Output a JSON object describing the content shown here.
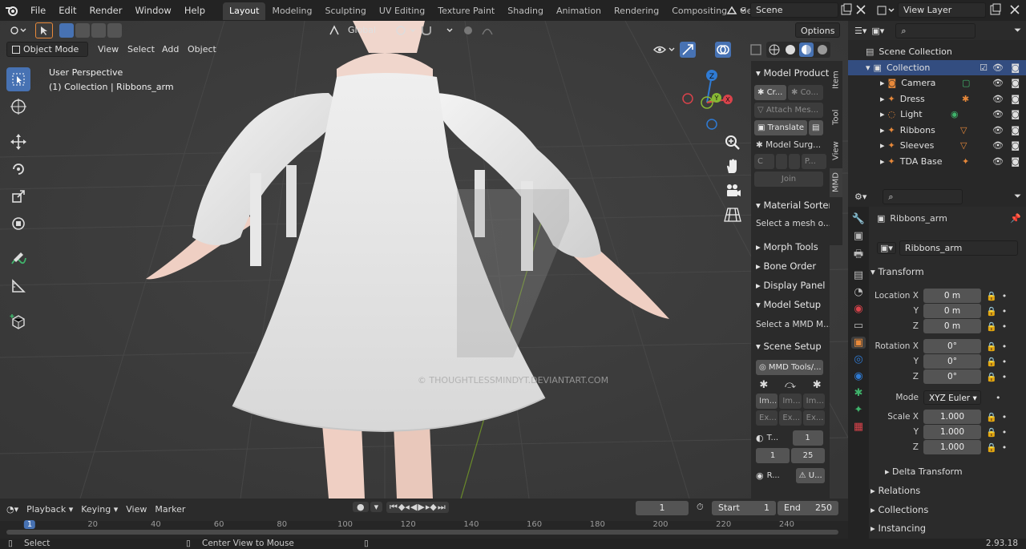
{
  "menu": {
    "file": "File",
    "edit": "Edit",
    "render": "Render",
    "window": "Window",
    "help": "Help"
  },
  "workspaces": [
    "Layout",
    "Modeling",
    "Sculpting",
    "UV Editing",
    "Texture Paint",
    "Shading",
    "Animation",
    "Rendering",
    "Compositing",
    "Geometry No"
  ],
  "scene": "Scene",
  "view_layer": "View Layer",
  "viewport": {
    "mode": "Object Mode",
    "view": "View",
    "select": "Select",
    "add": "Add",
    "object": "Object",
    "orientation": "Global",
    "options": "Options",
    "perspective": "User Perspective",
    "collection_info": "(1) Collection | Ribbons_arm",
    "watermark": "© THOUGHTLESSMINDYT.DEVIANTART.COM",
    "gizmo": {
      "z": "Z",
      "y": "Y",
      "x": "X"
    }
  },
  "npanel": {
    "tabs": [
      "Item",
      "Tool",
      "View",
      "MMD"
    ],
    "model_production": "Model Producti",
    "btn_create": "Cr...",
    "btn_convert": "Co...",
    "btn_attach": "Attach Mes...",
    "btn_translate": "Translate",
    "btn_model_surgery": "Model Surg...",
    "btn_c": "C",
    "btn_p": "P...",
    "btn_join": "Join",
    "material_sorter": "Material Sorter",
    "select_mesh": "Select a mesh o...",
    "morph_tools": "Morph Tools",
    "bone_order": "Bone Order",
    "display_panel": "Display Panel",
    "model_setup": "Model Setup",
    "select_mmd": "Select a MMD M...",
    "scene_setup": "Scene Setup",
    "mmd_tools": "MMD Tools/...",
    "im1": "Im...",
    "im2": "Im...",
    "im3": "Im...",
    "ex1": "Ex...",
    "ex2": "Ex...",
    "ex3": "Ex...",
    "t_label": "T...",
    "t_val": "1",
    "range_start": "1",
    "range_end": "25",
    "r_label": "R...",
    "u_label": "U..."
  },
  "outliner": {
    "scene_collection": "Scene Collection",
    "collection": "Collection",
    "items": [
      "Camera",
      "Dress",
      "Light",
      "Ribbons",
      "Sleeves",
      "TDA Base"
    ]
  },
  "properties": {
    "object_name": "Ribbons_arm",
    "object_field": "Ribbons_arm",
    "transform": "Transform",
    "location_x_label": "Location X",
    "location_x": "0 m",
    "y_label": "Y",
    "location_y": "0 m",
    "z_label": "Z",
    "location_z": "0 m",
    "rotation_x_label": "Rotation X",
    "rotation_x": "0°",
    "rotation_y": "0°",
    "rotation_z": "0°",
    "mode_label": "Mode",
    "mode": "XYZ Euler",
    "scale_x_label": "Scale X",
    "scale_x": "1.000",
    "scale_y": "1.000",
    "scale_z": "1.000",
    "delta_transform": "Delta Transform",
    "relations": "Relations",
    "collections": "Collections",
    "instancing": "Instancing"
  },
  "timeline": {
    "playback": "Playback",
    "keying": "Keying",
    "view": "View",
    "marker": "Marker",
    "current_frame": "1",
    "start_label": "Start",
    "start": "1",
    "end_label": "End",
    "end": "250",
    "ruler": [
      "1",
      "20",
      "40",
      "60",
      "80",
      "100",
      "120",
      "140",
      "160",
      "180",
      "200",
      "220",
      "240"
    ]
  },
  "status": {
    "select": "Select",
    "center": "Center View to Mouse",
    "version": "2.93.18"
  },
  "colors": {
    "accent": "#4772b3",
    "x_axis": "#d9434b",
    "y_axis": "#88b834",
    "z_axis": "#2f7bd4",
    "orange": "#e8893a"
  }
}
